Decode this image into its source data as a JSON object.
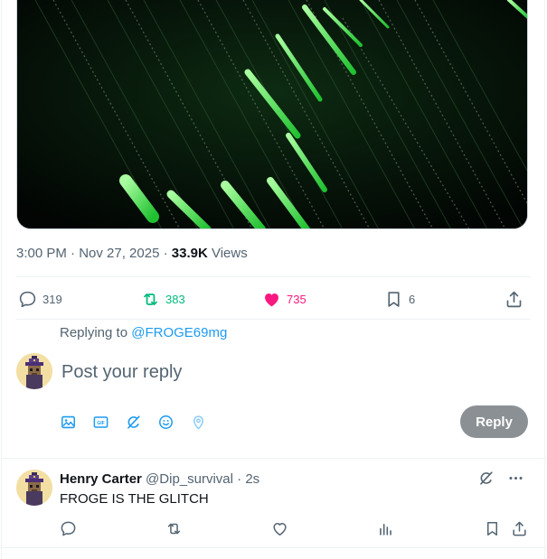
{
  "tweet": {
    "time": "3:00 PM · Nov 27, 2025 · ",
    "views_count": "33.9K",
    "views_label": " Views",
    "replies": "319",
    "reposts": "383",
    "likes": "735",
    "bookmarks": "6"
  },
  "composer": {
    "replying_prefix": "Replying to ",
    "replying_handle": "@FROGE69mg",
    "placeholder": "Post your reply",
    "reply_button": "Reply"
  },
  "reply_post": {
    "author_name": "Henry Carter",
    "author_handle": "@Dip_survival",
    "time": "2s",
    "text": "FROGE IS THE GLITCH"
  },
  "icons": {
    "reply": "comment-icon",
    "repost": "repost-icon",
    "like": "heart-icon",
    "bookmark": "bookmark-icon",
    "share": "share-icon",
    "image": "image-icon",
    "gif": "gif-icon",
    "grok": "grok-icon",
    "emoji": "emoji-icon",
    "location": "location-icon",
    "more": "more-icon",
    "analytics": "analytics-icon"
  },
  "colors": {
    "accent": "#1d9bf0",
    "repost_green": "#00ba7c",
    "like_pink": "#f91880",
    "muted": "#536471",
    "reply_button_bg": "#8b9094"
  }
}
